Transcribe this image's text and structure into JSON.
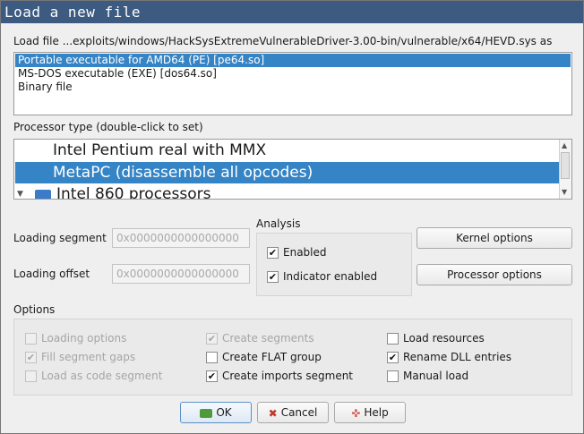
{
  "window": {
    "title": "Load a new file"
  },
  "file_label": "Load file ...exploits/windows/HackSysExtremeVulnerableDriver-3.00-bin/vulnerable/x64/HEVD.sys as",
  "formats": [
    {
      "label": "Portable executable for AMD64 (PE) [pe64.so]",
      "selected": true
    },
    {
      "label": "MS-DOS executable (EXE) [dos64.so]",
      "selected": false
    },
    {
      "label": "Binary file",
      "selected": false
    }
  ],
  "processor": {
    "label": "Processor type (double-click to set)",
    "items": [
      {
        "label": "Intel Pentium real with MMX",
        "selected": false
      },
      {
        "label": "MetaPC (disassemble all opcodes)",
        "selected": true
      },
      {
        "label": "Intel 860 processors",
        "selected": false
      }
    ]
  },
  "loading_segment": {
    "label": "Loading segment",
    "value": "0x0000000000000000"
  },
  "loading_offset": {
    "label": "Loading offset",
    "value": "0x0000000000000000"
  },
  "analysis": {
    "label": "Analysis",
    "enabled": {
      "label": "Enabled",
      "checked": true
    },
    "indicator": {
      "label": "Indicator enabled",
      "checked": true
    }
  },
  "buttons": {
    "kernel": "Kernel options",
    "processor": "Processor options",
    "ok": "OK",
    "cancel": "Cancel",
    "help": "Help"
  },
  "options": {
    "label": "Options",
    "loading_options": {
      "label": "Loading options",
      "checked": false,
      "enabled": false
    },
    "fill_segment_gaps": {
      "label": "Fill segment gaps",
      "checked": true,
      "enabled": false
    },
    "load_as_code_segment": {
      "label": "Load as code segment",
      "checked": false,
      "enabled": false
    },
    "create_segments": {
      "label": "Create segments",
      "checked": true,
      "enabled": false
    },
    "create_flat_group": {
      "label": "Create FLAT group",
      "checked": false,
      "enabled": true
    },
    "create_imports_segment": {
      "label": "Create imports segment",
      "checked": true,
      "enabled": true
    },
    "load_resources": {
      "label": "Load resources",
      "checked": false,
      "enabled": true
    },
    "rename_dll_entries": {
      "label": "Rename DLL entries",
      "checked": true,
      "enabled": true
    },
    "manual_load": {
      "label": "Manual load",
      "checked": false,
      "enabled": true
    }
  },
  "colors": {
    "titlebar": "#3d5a80",
    "selection": "#3584c5"
  }
}
